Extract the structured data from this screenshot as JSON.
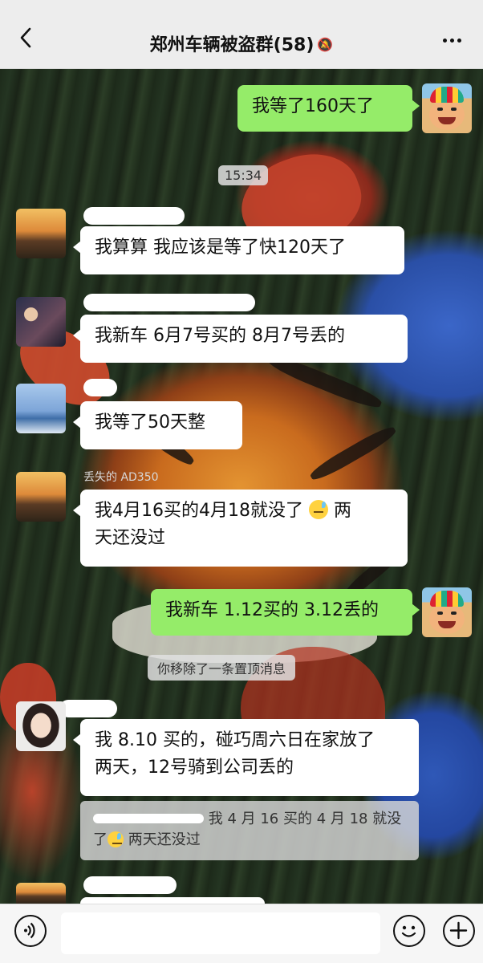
{
  "header": {
    "back_icon": "chevron-left-icon",
    "title": "郑州车辆被盗群(58)",
    "mute_icon": "bell-off-icon",
    "more_icon": "ellipsis-icon"
  },
  "messages": {
    "m1": {
      "text": "我等了160天了"
    },
    "time": "15:34",
    "m2": {
      "text": "我算算 我应该是等了快120天了"
    },
    "m3": {
      "text": "我新车  6月7号买的 8月7号丢的"
    },
    "m4": {
      "text": "我等了50天整"
    },
    "m5": {
      "sender": "丢失的 AD350",
      "line1": "我4月16买的4月18就没了",
      "line2": "两",
      "line3": "天还没过"
    },
    "m6": {
      "text": "我新车 1.12买的 3.12丢的"
    },
    "system": "你移除了一条置顶消息",
    "m7": {
      "line1": "我 8.10 买的，碰巧周六日在家放了",
      "line2": "两天，12号骑到公司丢的"
    },
    "quote": {
      "line1": "我 4 月 16 买的 4 月 18 就没",
      "line2": "了",
      "line3": "两天还没过"
    }
  },
  "bottom": {
    "voice_icon": "voice-icon",
    "emoji_icon": "emoji-icon",
    "plus_icon": "plus-icon"
  }
}
